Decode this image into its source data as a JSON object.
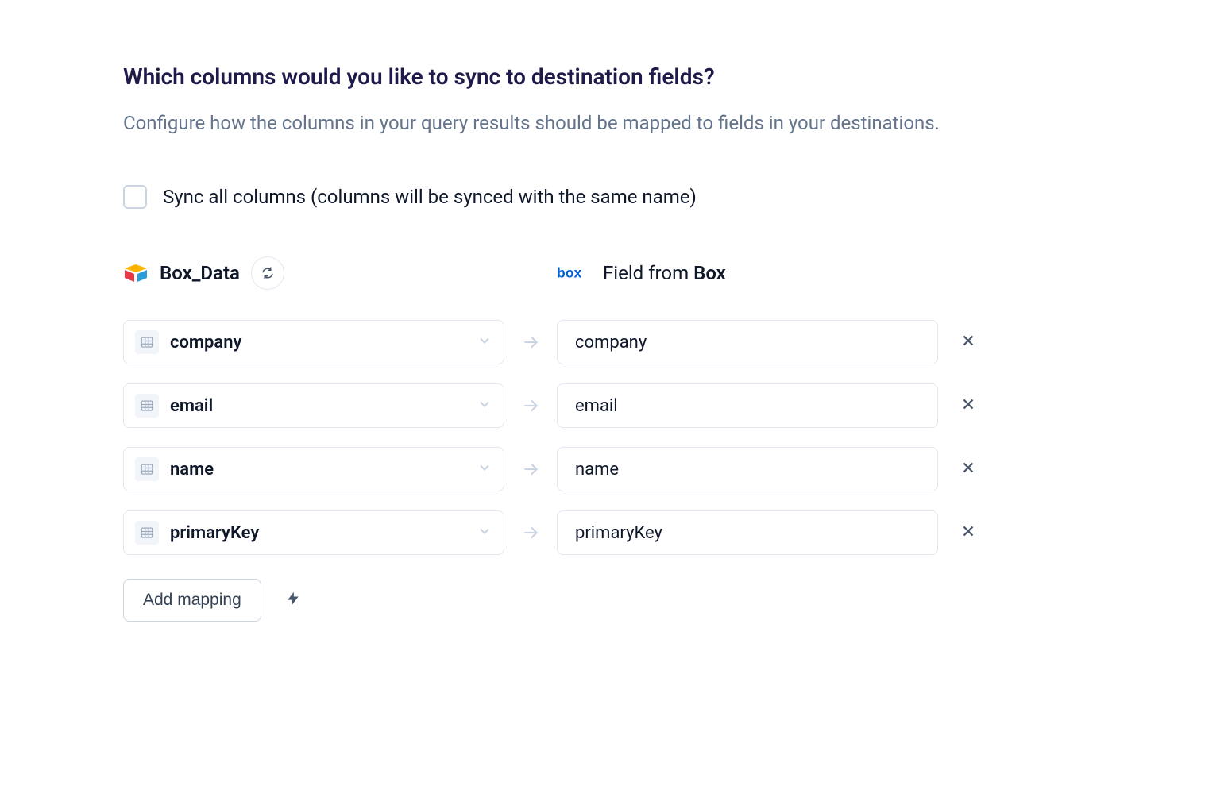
{
  "heading": "Which columns would you like to sync to destination fields?",
  "subheading": "Configure how the columns in your query results should be mapped to fields in your destinations.",
  "syncAll": {
    "label": "Sync all columns (columns will be synced with the same name)",
    "checked": false
  },
  "sourceHeader": {
    "label": "Box_Data"
  },
  "destHeader": {
    "prefix": "Field from ",
    "name": "Box"
  },
  "mappings": [
    {
      "source": "company",
      "dest": "company"
    },
    {
      "source": "email",
      "dest": "email"
    },
    {
      "source": "name",
      "dest": "name"
    },
    {
      "source": "primaryKey",
      "dest": "primaryKey"
    }
  ],
  "addMappingLabel": "Add mapping"
}
